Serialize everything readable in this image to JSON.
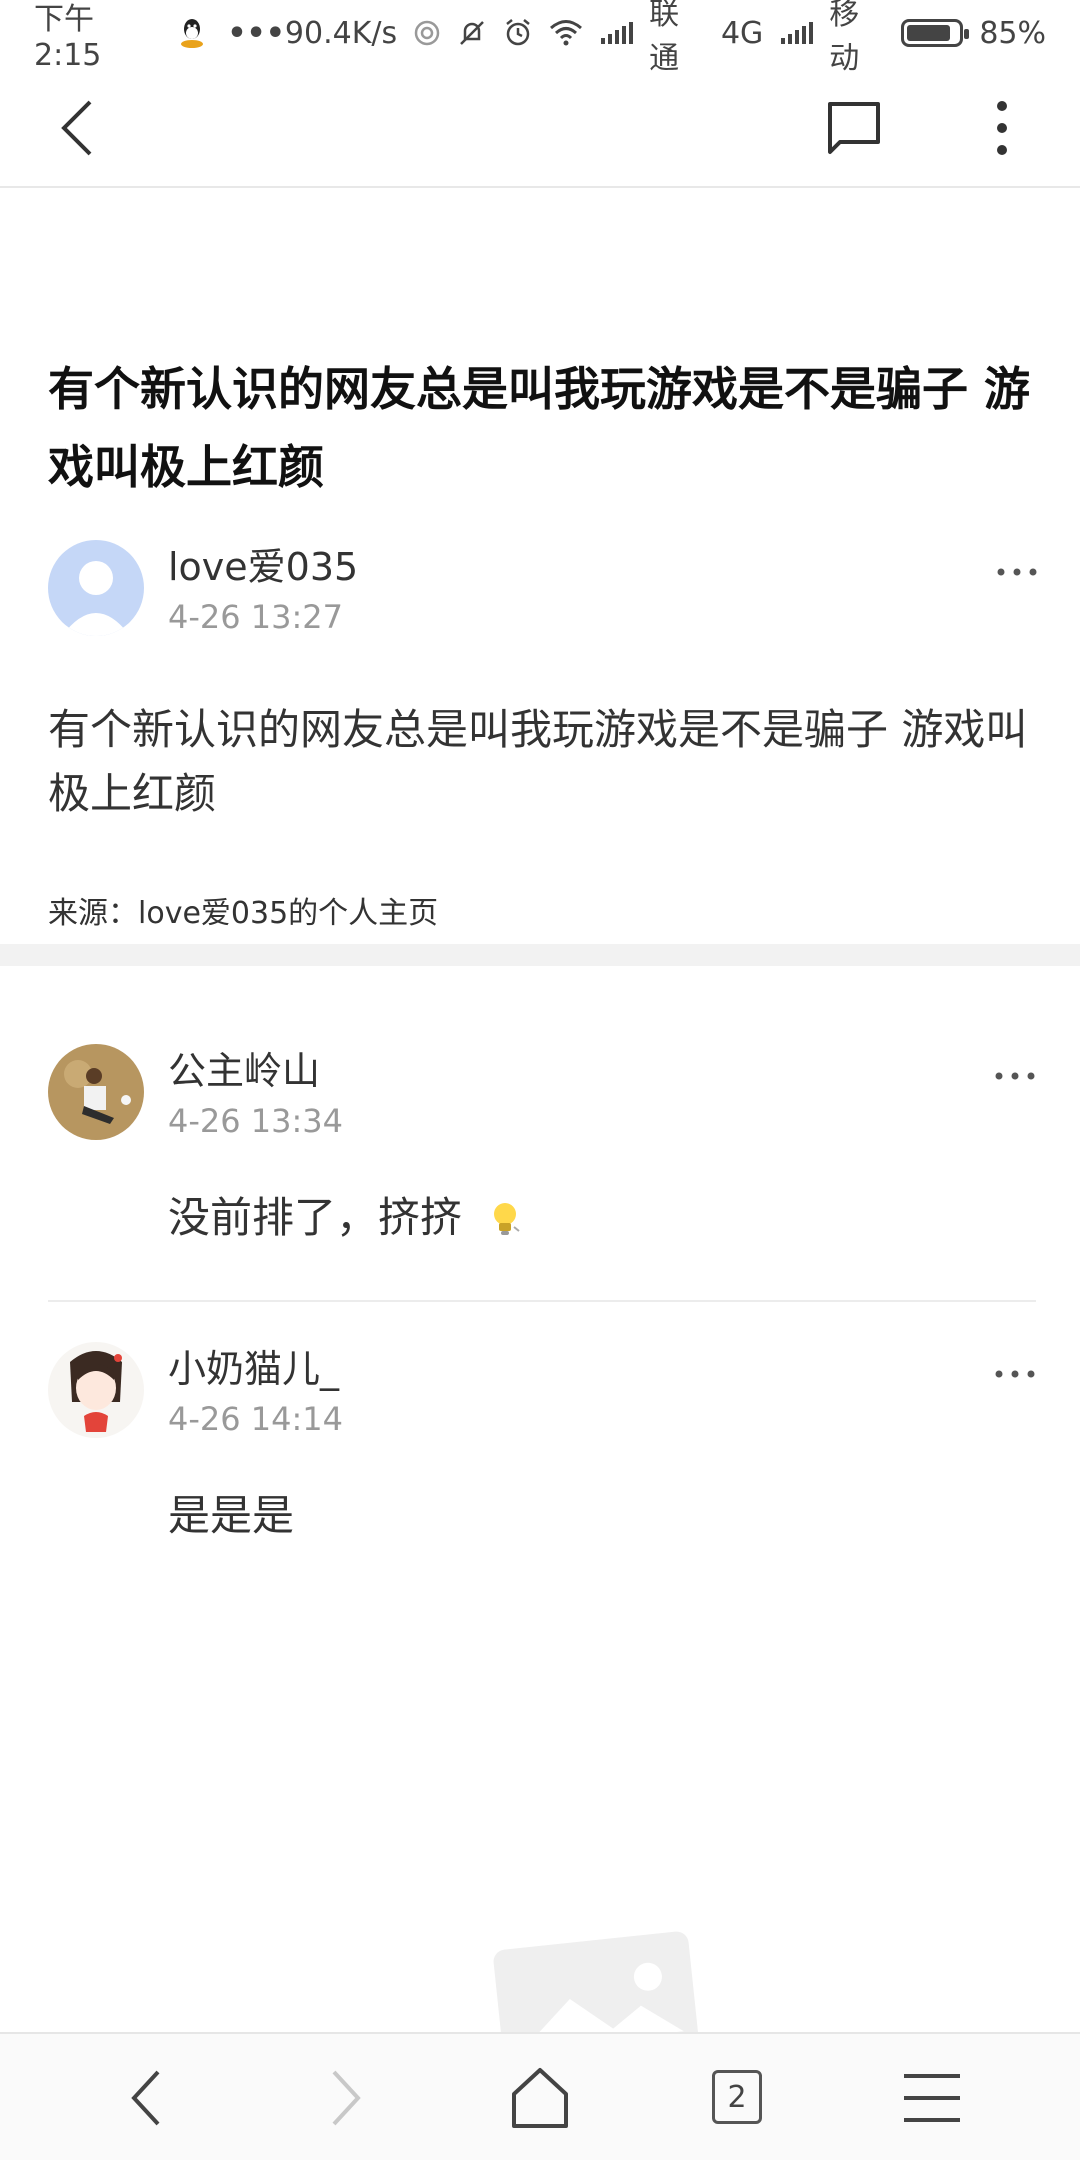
{
  "status_bar": {
    "time": "下午2:15",
    "dots": "•••",
    "net_speed": "90.4K/s",
    "carrier1": "联通",
    "network": "4G",
    "carrier2": "移动",
    "battery": "85%",
    "battery_level": 0.85
  },
  "post": {
    "title": "有个新认识的网友总是叫我玩游戏是不是骗子 游戏叫极上红颜",
    "author": "love爱035",
    "time": "4-26 13:27",
    "body": "有个新认识的网友总是叫我玩游戏是不是骗子 游戏叫极上红颜",
    "source": "来源：love爱035的个人主页"
  },
  "comments": [
    {
      "user": "公主岭山",
      "time": "4-26 13:34",
      "text": "没前排了，挤挤"
    },
    {
      "user": "小奶猫儿_",
      "time": "4-26 14:14",
      "text": "是是是"
    }
  ],
  "bottom_bar": {
    "tab_count": "2"
  },
  "colors": {
    "accent": "#111111",
    "muted": "#999999",
    "band": "#f2f2f2"
  }
}
